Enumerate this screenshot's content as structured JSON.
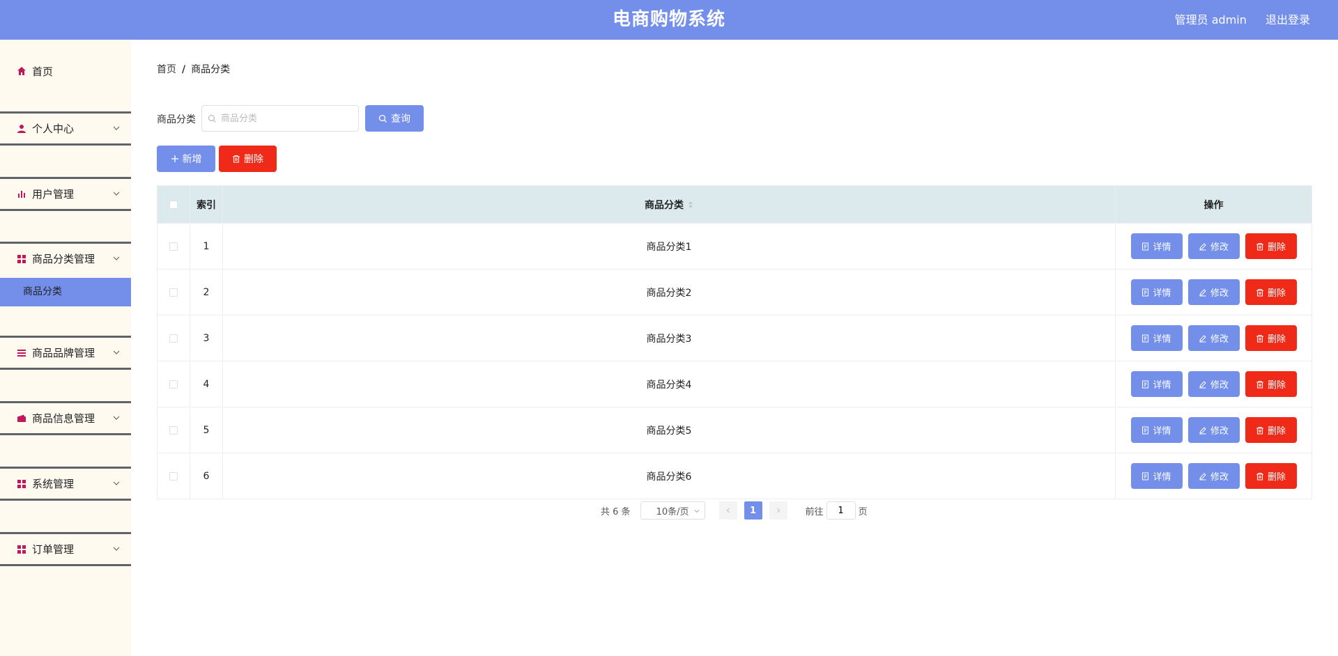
{
  "header": {
    "title": "电商购物系统",
    "admin_label": "管理员 admin",
    "logout_label": "退出登录"
  },
  "sidebar": {
    "home_label": "首页",
    "groups": [
      {
        "label": "个人中心",
        "icon": "user-icon"
      },
      {
        "label": "用户管理",
        "icon": "bar-chart-icon"
      },
      {
        "label": "商品分类管理",
        "icon": "grid-icon"
      },
      {
        "label": "商品品牌管理",
        "icon": "list-icon"
      },
      {
        "label": "商品信息管理",
        "icon": "wallet-icon"
      },
      {
        "label": "系统管理",
        "icon": "grid-icon"
      },
      {
        "label": "订单管理",
        "icon": "grid-icon"
      }
    ],
    "active_submenu": "商品分类"
  },
  "breadcrumb": {
    "home": "首页",
    "separator": "/",
    "current": "商品分类"
  },
  "search": {
    "label": "商品分类",
    "placeholder": "商品分类",
    "value": "",
    "button": "查询"
  },
  "actions": {
    "add": "新增",
    "delete": "删除"
  },
  "table": {
    "headers": {
      "index": "索引",
      "name": "商品分类",
      "ops": "操作"
    },
    "rows": [
      {
        "index": "1",
        "name": "商品分类1"
      },
      {
        "index": "2",
        "name": "商品分类2"
      },
      {
        "index": "3",
        "name": "商品分类3"
      },
      {
        "index": "4",
        "name": "商品分类4"
      },
      {
        "index": "5",
        "name": "商品分类5"
      },
      {
        "index": "6",
        "name": "商品分类6"
      }
    ],
    "row_actions": {
      "detail": "详情",
      "edit": "修改",
      "delete": "删除"
    }
  },
  "pagination": {
    "total": "共 6 条",
    "page_size": "10条/页",
    "current_page": "1",
    "goto_prefix": "前往",
    "goto_value": "1",
    "goto_suffix": "页"
  },
  "colors": {
    "primary": "#738fea",
    "danger": "#f02a18",
    "sidebar_bg": "#fffaf0",
    "table_header": "#dceaee",
    "icon": "#c2185b"
  }
}
